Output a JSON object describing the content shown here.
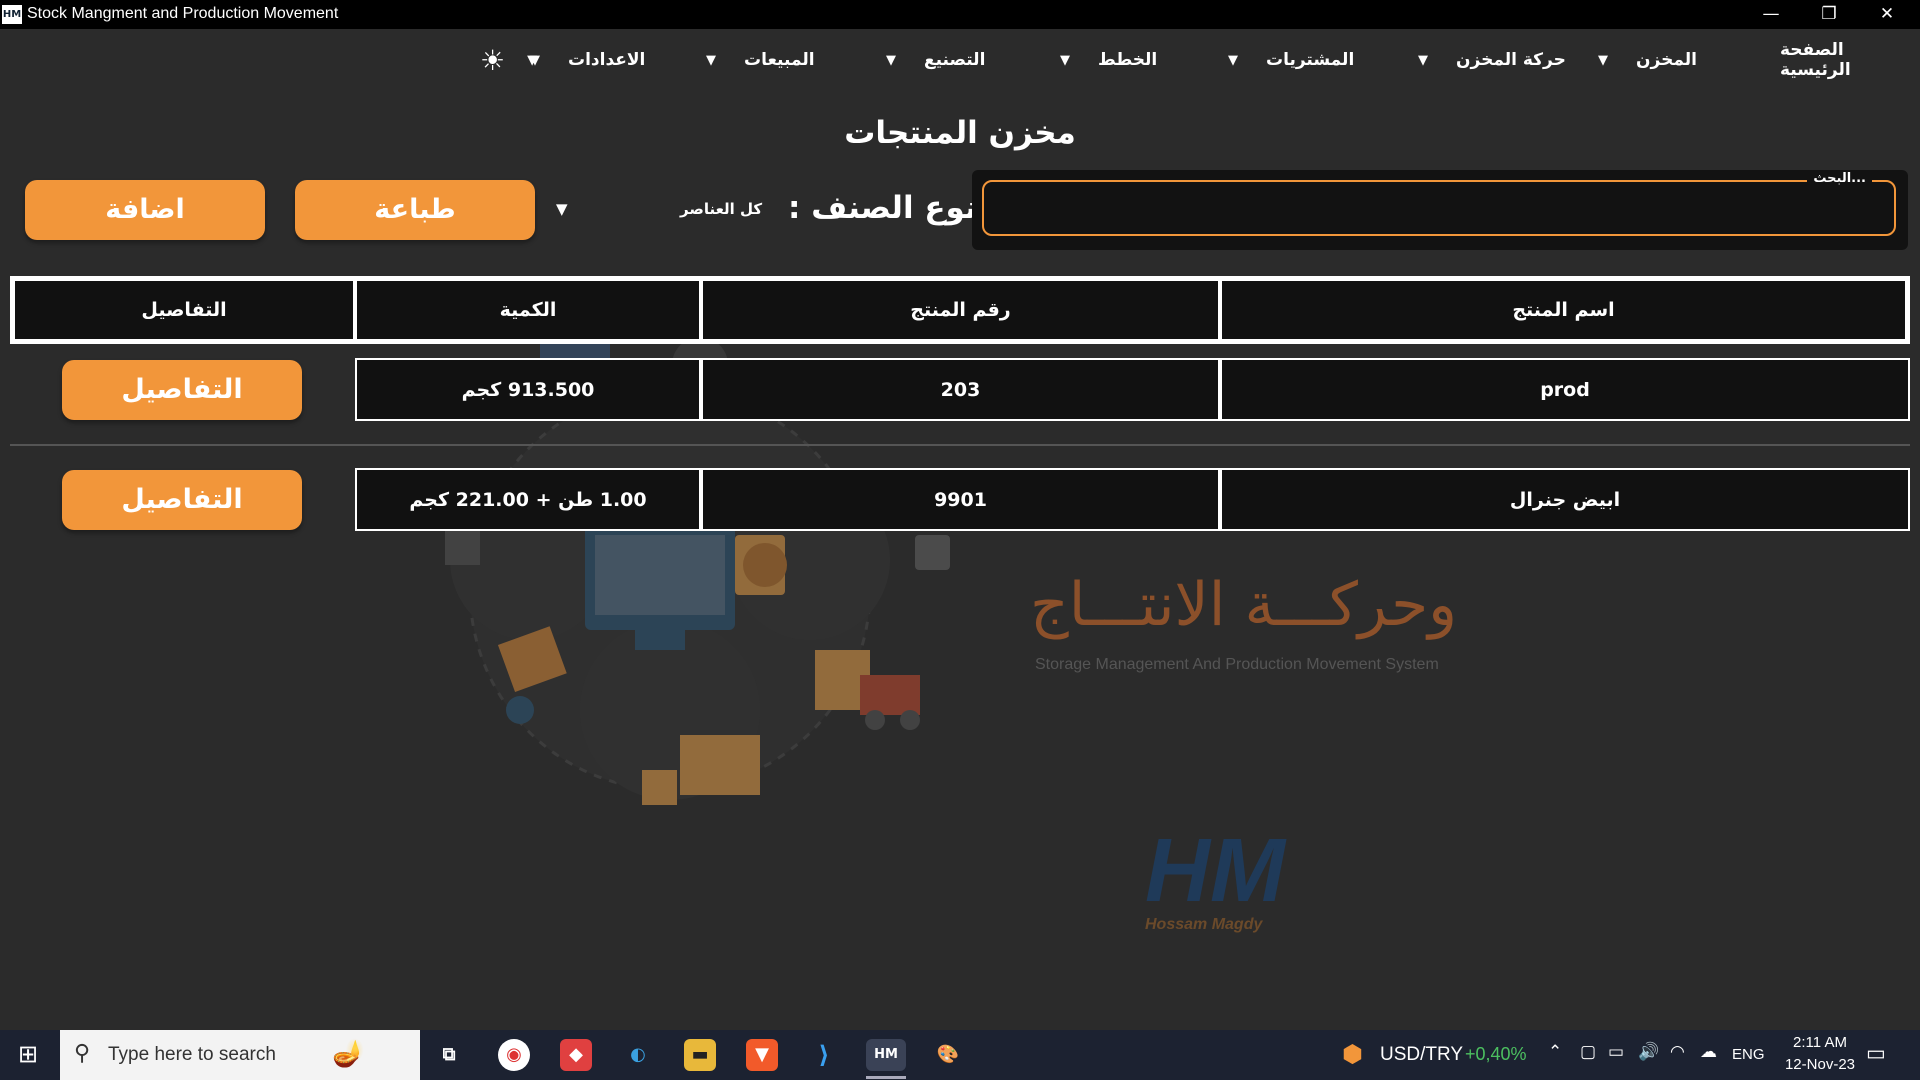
{
  "window": {
    "title": "Stock Mangment and Production Movement",
    "icon_text": "HM",
    "minimize": "—",
    "restore": "❐",
    "close": "✕"
  },
  "menu": {
    "home": "الصفحة الرئيسية",
    "store": "المخزن",
    "store_movement": "حركة المخزن",
    "purchases": "المشتريات",
    "plans": "الخطط",
    "manufacturing": "التصنيع",
    "sales": "المبيعات",
    "settings": "الاعدادات",
    "theme_icon": "sun-icon",
    "caret": "▼"
  },
  "page": {
    "title": "مخزن المنتجات"
  },
  "toolbar": {
    "search_label": "البحث...",
    "search_value": "",
    "category_label": "نوع الصنف :",
    "category_value": "كل العناصر",
    "print_label": "طباعة",
    "add_label": "اضافة"
  },
  "table": {
    "headers": {
      "name": "اسم المنتج",
      "number": "رقم المنتج",
      "quantity": "الكمية",
      "details": "التفاصيل"
    },
    "rows": [
      {
        "name": "prod",
        "number": "203",
        "quantity": "913.500 كجم",
        "details_label": "التفاصيل"
      },
      {
        "name": "ابيض جنرال",
        "number": "9901",
        "quantity": "1.00 طن + 221.00 كجم",
        "details_label": "التفاصيل"
      }
    ]
  },
  "watermark": {
    "arabic_text": "وحركـــة الانتـــاج",
    "english_text": "Storage Management And Production Movement System",
    "logo_text": "HM",
    "signature": "Hossam Magdy"
  },
  "taskbar": {
    "search_placeholder": "Type here to search",
    "ticker": "USD/TRY",
    "ticker_change": "+0,40%",
    "language": "ENG",
    "time": "2:11 AM",
    "date": "12-Nov-23",
    "accent_color": "#f2963a"
  }
}
